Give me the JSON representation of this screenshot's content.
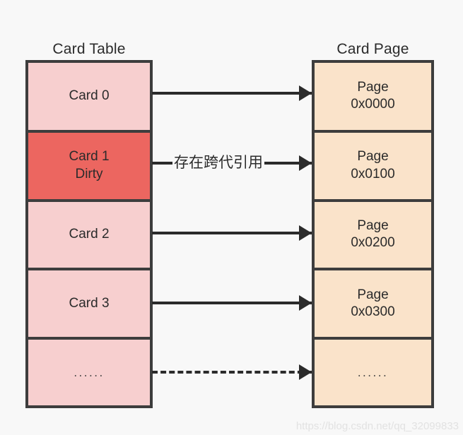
{
  "diagram": {
    "title_left": "Card Table",
    "title_right": "Card Page",
    "watermark": "https://blog.csdn.net/qq_32099833",
    "colors": {
      "background": "#f8f8f8",
      "card_fill": "#f7cfcf",
      "card_dirty_fill": "#ec6660",
      "page_fill": "#fae3ca",
      "border": "#3d3d3d",
      "connector": "#2b2b2b",
      "text": "#2b2b2b",
      "watermark": "#e2e2e2"
    },
    "card_table": {
      "rows": [
        {
          "label": "Card 0",
          "sublabel": "",
          "state": "clean"
        },
        {
          "label": "Card 1",
          "sublabel": "Dirty",
          "state": "dirty"
        },
        {
          "label": "Card 2",
          "sublabel": "",
          "state": "clean"
        },
        {
          "label": "Card 3",
          "sublabel": "",
          "state": "clean"
        },
        {
          "label": "......",
          "sublabel": "",
          "state": "clean"
        }
      ]
    },
    "card_page": {
      "rows": [
        {
          "label": "Page",
          "sublabel": "0x0000"
        },
        {
          "label": "Page",
          "sublabel": "0x0100"
        },
        {
          "label": "Page",
          "sublabel": "0x0200"
        },
        {
          "label": "Page",
          "sublabel": "0x0300"
        },
        {
          "label": "......",
          "sublabel": ""
        }
      ]
    },
    "connectors": [
      {
        "from": "Card 0",
        "to": "Page 0x0000",
        "style": "solid",
        "label": ""
      },
      {
        "from": "Card 1",
        "to": "Page 0x0100",
        "style": "solid",
        "label": "存在跨代引用"
      },
      {
        "from": "Card 2",
        "to": "Page 0x0200",
        "style": "solid",
        "label": ""
      },
      {
        "from": "Card 3",
        "to": "Page 0x0300",
        "style": "solid",
        "label": ""
      },
      {
        "from": "......",
        "to": "......",
        "style": "dashed",
        "label": ""
      }
    ]
  }
}
